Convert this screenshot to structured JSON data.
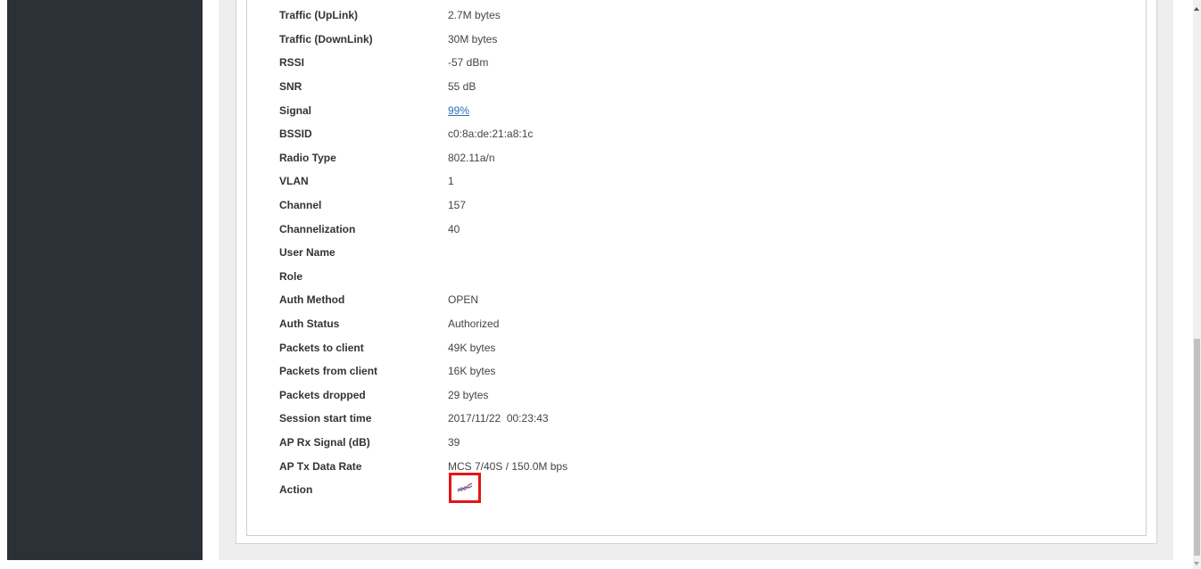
{
  "client_details": {
    "rows": [
      {
        "label": "Traffic (UpLink)",
        "value": "2.7M bytes"
      },
      {
        "label": "Traffic (DownLink)",
        "value": "30M bytes"
      },
      {
        "label": "RSSI",
        "value": "-57 dBm"
      },
      {
        "label": "SNR",
        "value": "55 dB"
      },
      {
        "label": "Signal",
        "value": "99%"
      },
      {
        "label": "BSSID",
        "value": "c0:8a:de:21:a8:1c"
      },
      {
        "label": "Radio Type",
        "value": "802.11a/n"
      },
      {
        "label": "VLAN",
        "value": "1"
      },
      {
        "label": "Channel",
        "value": "157"
      },
      {
        "label": "Channelization",
        "value": "40"
      },
      {
        "label": "User Name",
        "value": ""
      },
      {
        "label": "Role",
        "value": ""
      },
      {
        "label": "Auth Method",
        "value": "OPEN"
      },
      {
        "label": "Auth Status",
        "value": "Authorized"
      },
      {
        "label": "Packets to client",
        "value": "49K bytes"
      },
      {
        "label": "Packets from client",
        "value": "16K bytes"
      },
      {
        "label": "Packets dropped",
        "value": "29 bytes"
      },
      {
        "label": "Session start time",
        "value": "2017/11/22  00:23:43"
      },
      {
        "label": "AP Rx Signal (dB)",
        "value": "39"
      },
      {
        "label": "AP Tx Data Rate",
        "value": "MCS 7/40S / 150.0M bps"
      },
      {
        "label": "Action",
        "value": ""
      }
    ],
    "action_icon": "chart-line-icon",
    "highlight_color": "#e41515",
    "link_color": "#2a6fb5"
  },
  "theme": {
    "sidebar_color": "#2b3137",
    "content_background": "#eeeeee"
  }
}
